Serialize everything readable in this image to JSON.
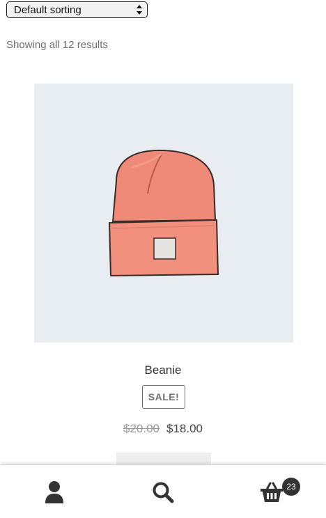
{
  "toolbar": {
    "sorting_value": "Default sorting",
    "result_count": "Showing all 12 results"
  },
  "product": {
    "title": "Beanie",
    "sale_badge": "SALE!",
    "regular_price": "$20.00",
    "sale_price": "$18.00",
    "image_icon": "beanie-hat-illustration"
  },
  "footer": {
    "account_icon": "user-icon",
    "search_icon": "search-icon",
    "cart_icon": "basket-icon",
    "cart_count": "23"
  },
  "colors": {
    "image_background": "#e8edf1",
    "hat": "#f08a78",
    "text": "#43454b"
  }
}
